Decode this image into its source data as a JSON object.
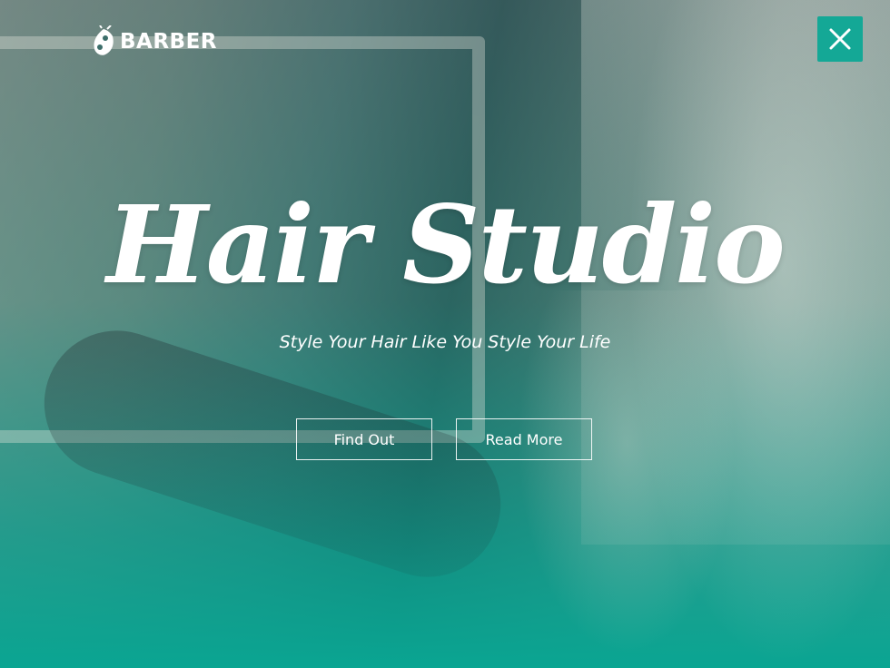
{
  "brand": {
    "name": "BARBER"
  },
  "hero": {
    "title": "Hair Studio",
    "subtitle": "Style Your Hair Like You Style Your Life"
  },
  "buttons": {
    "find_out": "Find Out",
    "read_more": "Read More"
  },
  "icons": {
    "logo": "barber-logo-icon",
    "close": "close-icon"
  },
  "colors": {
    "accent": "#14a896",
    "overlay_bottom": "#0aa592",
    "text": "#ffffff"
  }
}
